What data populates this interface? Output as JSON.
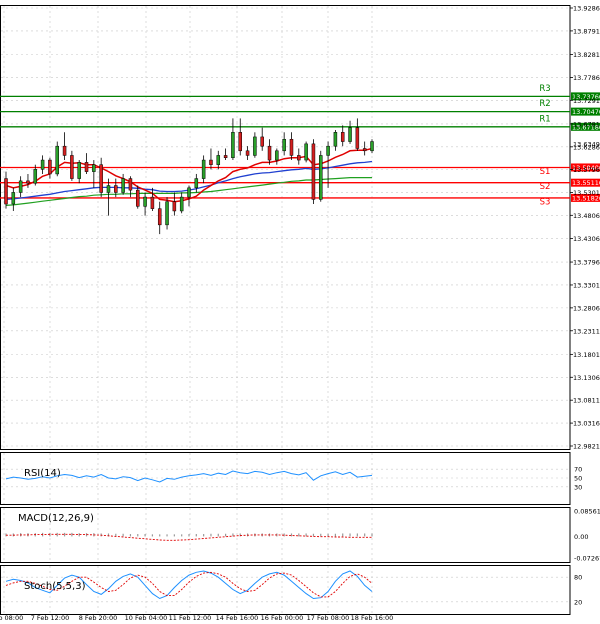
{
  "chart_data": {
    "type": "candlestick",
    "main": {
      "price_ticks": [
        "13.92860",
        "13.87910",
        "13.82810",
        "13.77860",
        "13.72910",
        "13.67810",
        "13.62860",
        "13.57960",
        "13.53010",
        "13.48060",
        "13.43060",
        "13.37960",
        "13.33010",
        "13.28060",
        "13.23110",
        "13.18010",
        "13.13060",
        "13.08110",
        "13.03160",
        "12.98210"
      ],
      "price_values": [
        13.9286,
        13.8791,
        13.8281,
        13.7786,
        13.7291,
        13.6781,
        13.6286,
        13.5796,
        13.5301,
        13.4806,
        13.4306,
        13.3796,
        13.3301,
        13.2806,
        13.2311,
        13.1801,
        13.1306,
        13.0811,
        13.0316,
        12.9821
      ],
      "ylim": [
        12.9821,
        13.9286
      ],
      "date_labels": [
        "6 Feb 08:00",
        "7 Feb 12:00",
        "8 Feb 20:00",
        "10 Feb 04:00",
        "11 Feb 12:00",
        "14 Feb 16:00",
        "16 Feb 00:00",
        "17 Feb 08:00",
        "18 Feb 16:00"
      ],
      "current_price": {
        "label": "13.63490",
        "value": 13.6349
      },
      "levels": [
        {
          "name": "R3",
          "value": 13.7376,
          "label": "13.73760",
          "color": "#008000"
        },
        {
          "name": "R2",
          "value": 13.7047,
          "label": "13.70470",
          "color": "#008000"
        },
        {
          "name": "R1",
          "value": 13.6718,
          "label": "13.67180",
          "color": "#008000"
        },
        {
          "name": "S1",
          "value": 13.584,
          "label": "13.58400",
          "color": "#ff0000"
        },
        {
          "name": "S2",
          "value": 13.5511,
          "label": "13.55110",
          "color": "#ff0000"
        },
        {
          "name": "S3",
          "value": 13.5182,
          "label": "13.51820",
          "color": "#ff0000"
        }
      ],
      "candles": [
        [
          13.56,
          13.575,
          13.495,
          13.505
        ],
        [
          13.505,
          13.54,
          13.49,
          13.53
        ],
        [
          13.53,
          13.565,
          13.52,
          13.555
        ],
        [
          13.555,
          13.57,
          13.54,
          13.55
        ],
        [
          13.55,
          13.59,
          13.545,
          13.58
        ],
        [
          13.58,
          13.61,
          13.57,
          13.6
        ],
        [
          13.6,
          13.605,
          13.56,
          13.57
        ],
        [
          13.57,
          13.64,
          13.565,
          13.63
        ],
        [
          13.63,
          13.66,
          13.6,
          13.61
        ],
        [
          13.61,
          13.62,
          13.555,
          13.56
        ],
        [
          13.56,
          13.6,
          13.55,
          13.595
        ],
        [
          13.595,
          13.615,
          13.57,
          13.575
        ],
        [
          13.575,
          13.6,
          13.54,
          13.59
        ],
        [
          13.59,
          13.605,
          13.52,
          13.53
        ],
        [
          13.53,
          13.56,
          13.48,
          13.545
        ],
        [
          13.545,
          13.56,
          13.52,
          13.53
        ],
        [
          13.53,
          13.57,
          13.525,
          13.56
        ],
        [
          13.56,
          13.565,
          13.52,
          13.535
        ],
        [
          13.535,
          13.545,
          13.495,
          13.5
        ],
        [
          13.5,
          13.53,
          13.48,
          13.52
        ],
        [
          13.52,
          13.54,
          13.49,
          13.495
        ],
        [
          13.495,
          13.51,
          13.44,
          13.46
        ],
        [
          13.46,
          13.52,
          13.45,
          13.51
        ],
        [
          13.51,
          13.53,
          13.48,
          13.49
        ],
        [
          13.49,
          13.53,
          13.485,
          13.52
        ],
        [
          13.52,
          13.545,
          13.5,
          13.54
        ],
        [
          13.54,
          13.57,
          13.53,
          13.56
        ],
        [
          13.56,
          13.61,
          13.55,
          13.6
        ],
        [
          13.6,
          13.625,
          13.58,
          13.59
        ],
        [
          13.59,
          13.62,
          13.58,
          13.61
        ],
        [
          13.61,
          13.625,
          13.6,
          13.605
        ],
        [
          13.605,
          13.69,
          13.6,
          13.66
        ],
        [
          13.66,
          13.69,
          13.61,
          13.62
        ],
        [
          13.62,
          13.63,
          13.6,
          13.61
        ],
        [
          13.61,
          13.66,
          13.605,
          13.65
        ],
        [
          13.65,
          13.67,
          13.62,
          13.63
        ],
        [
          13.63,
          13.645,
          13.59,
          13.6
        ],
        [
          13.6,
          13.625,
          13.59,
          13.62
        ],
        [
          13.62,
          13.66,
          13.61,
          13.645
        ],
        [
          13.645,
          13.66,
          13.6,
          13.61
        ],
        [
          13.61,
          13.625,
          13.59,
          13.6
        ],
        [
          13.6,
          13.64,
          13.595,
          13.635
        ],
        [
          13.635,
          13.645,
          13.505,
          13.515
        ],
        [
          13.515,
          13.62,
          13.51,
          13.61
        ],
        [
          13.61,
          13.64,
          13.54,
          13.63
        ],
        [
          13.63,
          13.665,
          13.62,
          13.66
        ],
        [
          13.66,
          13.675,
          13.63,
          13.64
        ],
        [
          13.64,
          13.685,
          13.635,
          13.67
        ],
        [
          13.67,
          13.69,
          13.62,
          13.625
        ],
        [
          13.625,
          13.64,
          13.61,
          13.62
        ],
        [
          13.62,
          13.645,
          13.615,
          13.64
        ]
      ],
      "ma_red": [
        13.545,
        13.54,
        13.543,
        13.547,
        13.554,
        13.565,
        13.57,
        13.585,
        13.595,
        13.593,
        13.594,
        13.59,
        13.59,
        13.583,
        13.575,
        13.566,
        13.56,
        13.553,
        13.542,
        13.535,
        13.528,
        13.515,
        13.513,
        13.51,
        13.512,
        13.516,
        13.522,
        13.535,
        13.545,
        13.555,
        13.562,
        13.575,
        13.58,
        13.583,
        13.59,
        13.595,
        13.595,
        13.598,
        13.603,
        13.605,
        13.605,
        13.608,
        13.59,
        13.592,
        13.598,
        13.606,
        13.612,
        13.62,
        13.621,
        13.621,
        13.625
      ],
      "ma_blue": [
        13.515,
        13.516,
        13.518,
        13.52,
        13.522,
        13.524,
        13.526,
        13.529,
        13.532,
        13.534,
        13.536,
        13.538,
        13.54,
        13.541,
        13.541,
        13.541,
        13.54,
        13.54,
        13.539,
        13.537,
        13.536,
        13.533,
        13.532,
        13.532,
        13.533,
        13.535,
        13.538,
        13.542,
        13.546,
        13.551,
        13.555,
        13.56,
        13.564,
        13.567,
        13.57,
        13.572,
        13.573,
        13.575,
        13.577,
        13.579,
        13.58,
        13.582,
        13.58,
        13.581,
        13.583,
        13.586,
        13.589,
        13.592,
        13.594,
        13.595,
        13.597
      ],
      "ma_green": [
        13.502,
        13.503,
        13.505,
        13.507,
        13.509,
        13.511,
        13.513,
        13.515,
        13.517,
        13.519,
        13.521,
        13.522,
        13.524,
        13.525,
        13.526,
        13.526,
        13.527,
        13.527,
        13.528,
        13.528,
        13.528,
        13.528,
        13.528,
        13.528,
        13.529,
        13.529,
        13.53,
        13.531,
        13.532,
        13.534,
        13.536,
        13.538,
        13.54,
        13.542,
        13.544,
        13.546,
        13.548,
        13.55,
        13.552,
        13.554,
        13.555,
        13.557,
        13.557,
        13.558,
        13.559,
        13.56,
        13.561,
        13.562,
        13.562,
        13.562,
        13.562
      ]
    },
    "rsi": {
      "label": "RSI(14)",
      "ticks": [
        "70",
        "50",
        "30"
      ],
      "tick_values": [
        70,
        50,
        30
      ],
      "values": [
        48,
        52,
        50,
        47,
        49,
        53,
        50,
        55,
        58,
        56,
        51,
        55,
        52,
        58,
        50,
        48,
        53,
        51,
        44,
        50,
        46,
        41,
        49,
        47,
        52,
        55,
        57,
        60,
        56,
        61,
        58,
        66,
        62,
        60,
        65,
        63,
        58,
        62,
        65,
        60,
        57,
        62,
        45,
        55,
        60,
        64,
        58,
        63,
        52,
        54,
        56
      ]
    },
    "macd": {
      "label": "MACD(12,26,9)",
      "ticks": [
        "0.085619",
        "0.00",
        "-0.07267"
      ],
      "tick_values": [
        0.085619,
        0,
        -0.07267
      ],
      "hist": [
        0.01,
        0.01,
        0.011,
        0.011,
        0.011,
        0.012,
        0.012,
        0.012,
        0.012,
        0.012,
        0.011,
        0.011,
        0.011,
        0.01,
        0.01,
        0.009,
        0.009,
        0.008,
        0.008,
        0.008,
        0.007,
        0.007,
        0.007,
        0.007,
        0.007,
        0.008,
        0.008,
        0.008,
        0.009,
        0.009,
        0.009,
        0.01,
        0.01,
        0.01,
        0.01,
        0.01,
        0.01,
        0.01,
        0.01,
        0.01,
        0.01,
        0.01,
        0.009,
        0.009,
        0.009,
        0.009,
        0.01,
        0.01,
        0.01,
        0.01,
        0.01
      ],
      "signal": [
        0.004,
        0.004,
        0.005,
        0.005,
        0.006,
        0.006,
        0.007,
        0.007,
        0.007,
        0.007,
        0.006,
        0.006,
        0.005,
        0.004,
        0.002,
        0.0,
        -0.002,
        -0.004,
        -0.006,
        -0.008,
        -0.01,
        -0.012,
        -0.013,
        -0.013,
        -0.012,
        -0.011,
        -0.009,
        -0.007,
        -0.005,
        -0.003,
        -0.001,
        0.001,
        0.003,
        0.004,
        0.005,
        0.005,
        0.005,
        0.005,
        0.004,
        0.003,
        0.002,
        0.001,
        0.0,
        -0.001,
        -0.001,
        -0.002,
        -0.002,
        -0.003,
        -0.003,
        -0.003,
        -0.003
      ]
    },
    "stoch": {
      "label": "Stoch(5,5,3)",
      "ticks": [
        "80",
        "20"
      ],
      "tick_values": [
        80,
        20
      ],
      "k": [
        70,
        75,
        72,
        66,
        55,
        48,
        42,
        60,
        78,
        85,
        80,
        62,
        45,
        38,
        52,
        70,
        82,
        88,
        80,
        60,
        40,
        28,
        35,
        55,
        72,
        85,
        92,
        95,
        90,
        80,
        65,
        50,
        40,
        48,
        65,
        80,
        88,
        92,
        85,
        70,
        55,
        40,
        28,
        30,
        45,
        70,
        88,
        95,
        82,
        60,
        45
      ],
      "d": [
        60,
        66,
        70,
        70,
        65,
        58,
        50,
        48,
        58,
        70,
        80,
        80,
        68,
        55,
        45,
        48,
        62,
        78,
        85,
        80,
        65,
        45,
        35,
        35,
        50,
        68,
        82,
        90,
        92,
        88,
        80,
        65,
        52,
        45,
        48,
        62,
        78,
        88,
        90,
        85,
        72,
        57,
        42,
        32,
        32,
        45,
        65,
        82,
        88,
        80,
        65
      ]
    }
  }
}
